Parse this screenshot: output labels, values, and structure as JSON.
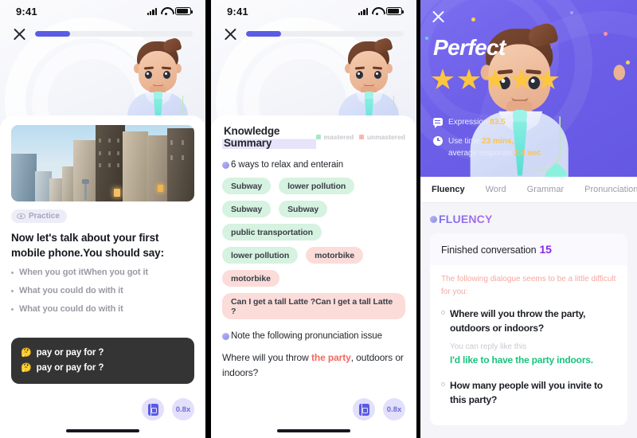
{
  "status_bar": {
    "time": "9:41",
    "signal_icon": "cellular-signal-icon",
    "wifi_icon": "wifi-icon",
    "battery_icon": "battery-icon"
  },
  "panel1": {
    "close_label": "close-icon",
    "progress_percent": 22,
    "lesson_image_alt": "city-street-buildings",
    "practice_badge": "Practice",
    "prompt": "Now let's talk about your first mobile phone.You should say:",
    "bullets": [
      "When you got itWhen you got it",
      "What you could do with it",
      "What you could do with it"
    ],
    "subtitles": [
      {
        "emoji": "🤔",
        "text": "pay or pay for ?"
      },
      {
        "emoji": "🤔",
        "text": "pay or pay for ?"
      }
    ],
    "controls": {
      "book_icon": "subtitle-book-icon",
      "speed": "0.8x"
    }
  },
  "panel2": {
    "close_label": "close-icon",
    "progress_percent": 22,
    "title": "Knowledge Summary",
    "legend": [
      {
        "label": "mastered",
        "color": "#a9e7c5"
      },
      {
        "label": "unmastered",
        "color": "#f9b5ae"
      }
    ],
    "section_title": "6 ways to relax and enterain",
    "tags": [
      {
        "text": "Subway",
        "state": "green"
      },
      {
        "text": "lower pollution",
        "state": "green"
      },
      {
        "text": "Subway",
        "state": "green"
      },
      {
        "text": "Subway",
        "state": "green"
      },
      {
        "text": "public transportation",
        "state": "green"
      },
      {
        "text": "lower pollution",
        "state": "green"
      },
      {
        "text": "motorbike",
        "state": "pink"
      },
      {
        "text": "motorbike",
        "state": "pink"
      },
      {
        "text": "Can I get a tall Latte ?Can I get a tall Latte ?",
        "state": "pink"
      }
    ],
    "note_title": "Note the following pronunciation issue",
    "sentence_before": "Where will you throw ",
    "sentence_highlight": "the party",
    "sentence_after": ", outdoors or indoors?",
    "controls": {
      "book_icon": "subtitle-book-icon",
      "speed": "0.8x"
    }
  },
  "panel3": {
    "close_label": "close-icon",
    "result_title": "Perfect",
    "stars": 5,
    "stats": [
      {
        "icon": "speech-bubble-icon",
        "label": "Expression ",
        "value": "83.5",
        "suffix": ""
      },
      {
        "icon": "clock-icon",
        "label": "Use time ",
        "value": "23 mins,",
        "line2_label": "average response ",
        "line2_value": "2.4 sec"
      }
    ],
    "tabs": [
      {
        "label": "Fluency",
        "active": true
      },
      {
        "label": "Word",
        "active": false
      },
      {
        "label": "Grammar",
        "active": false
      },
      {
        "label": "Pronunciation",
        "active": false
      }
    ],
    "section_label": "FLUENCY",
    "card_title": "Finished conversation",
    "card_count": "15",
    "hint": "The following dialogue seems to be a little difficult for you:",
    "items": [
      {
        "question": "Where will you throw the party, outdoors or indoors?",
        "reply_label": "You can reply like this",
        "reply": "I'd like to have the party indoors."
      },
      {
        "question": "How many people will you invite to this party?",
        "reply_label": "",
        "reply": ""
      }
    ]
  },
  "colors": {
    "accent_purple": "#5b5be4",
    "hero_purple": "#6d5fe8",
    "star_gold": "#fdc63f",
    "green_tag": "#d6f2e0",
    "pink_tag": "#fbdcd9",
    "reply_green": "#19c37d",
    "highlight_red": "#f4685e"
  }
}
